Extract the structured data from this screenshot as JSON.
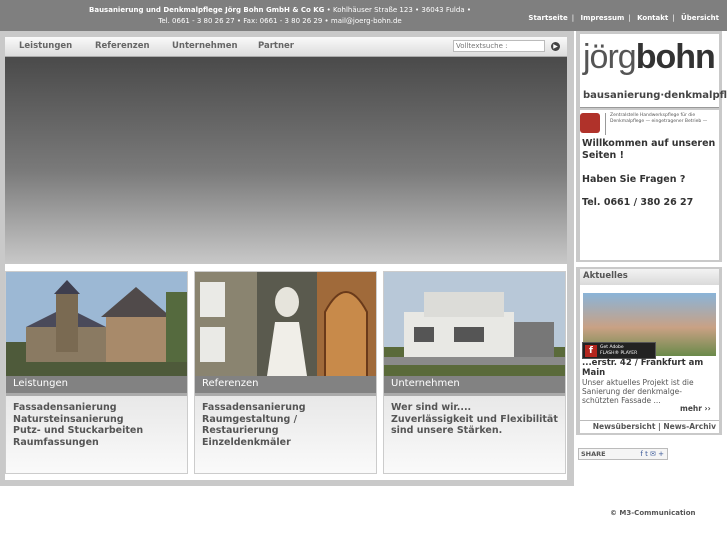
{
  "header": {
    "company_name": "Bausanierung und Denkmalpflege Jörg Bohn GmbH & Co KG",
    "address": " • Kohlhäuser Straße 123 • 36043 Fulda •",
    "contact": "Tel. 0661 - 3 80 26 27 • Fax: 0661 - 3 80 26 29 • mail@joerg-bohn.de",
    "links": [
      "Startseite",
      "Impressum",
      "Kontakt",
      "Übersicht"
    ]
  },
  "nav": {
    "items": [
      "Leistungen",
      "Referenzen",
      "Unternehmen",
      "Partner"
    ],
    "search_placeholder": "Volltextsuche :"
  },
  "cards": [
    {
      "title": "Leistungen",
      "lines": [
        "Fassadensanierung",
        "Natursteinsanierung",
        "Putz- und Stuckarbeiten",
        "Raumfassungen"
      ]
    },
    {
      "title": "Referenzen",
      "lines": [
        "Fassadensanierung",
        "Raumgestaltung / Restaurierung",
        "Einzeldenkmäler"
      ]
    },
    {
      "title": "Unternehmen",
      "lines": [
        "Wer sind wir....",
        "Zuverlässigkeit und Flexibilität",
        "sind unsere Stärken."
      ]
    }
  ],
  "sidebar": {
    "logo_part1": "jörg",
    "logo_part2": "bohn",
    "logo_tagline": "bausanierung·denkmalpflege",
    "badge_text": "Zentralstelle Handwerkspflege für die Denkmalpflege — eingetragener Betrieb —",
    "welcome": "Willkommen auf unseren Seiten !",
    "questions": "Haben Sie Fragen ?",
    "tel": "Tel. 0661 / 380 26 27"
  },
  "news": {
    "heading": "Aktuelles",
    "flash_label_1": "Get Adobe",
    "flash_label_2": "FLASH® PLAYER",
    "title": "...erstr. 42 / Frankfurt am Main",
    "text": "Unser aktuelles Projekt ist die Sanierung der denkmalge-schützten Fassade ...",
    "more": "mehr ››",
    "links": "Newsübersicht | News-Archiv"
  },
  "share": {
    "label": "SHARE",
    "icons": "f t ✉ +"
  },
  "footer": {
    "copyright": "© M3-Communication"
  }
}
